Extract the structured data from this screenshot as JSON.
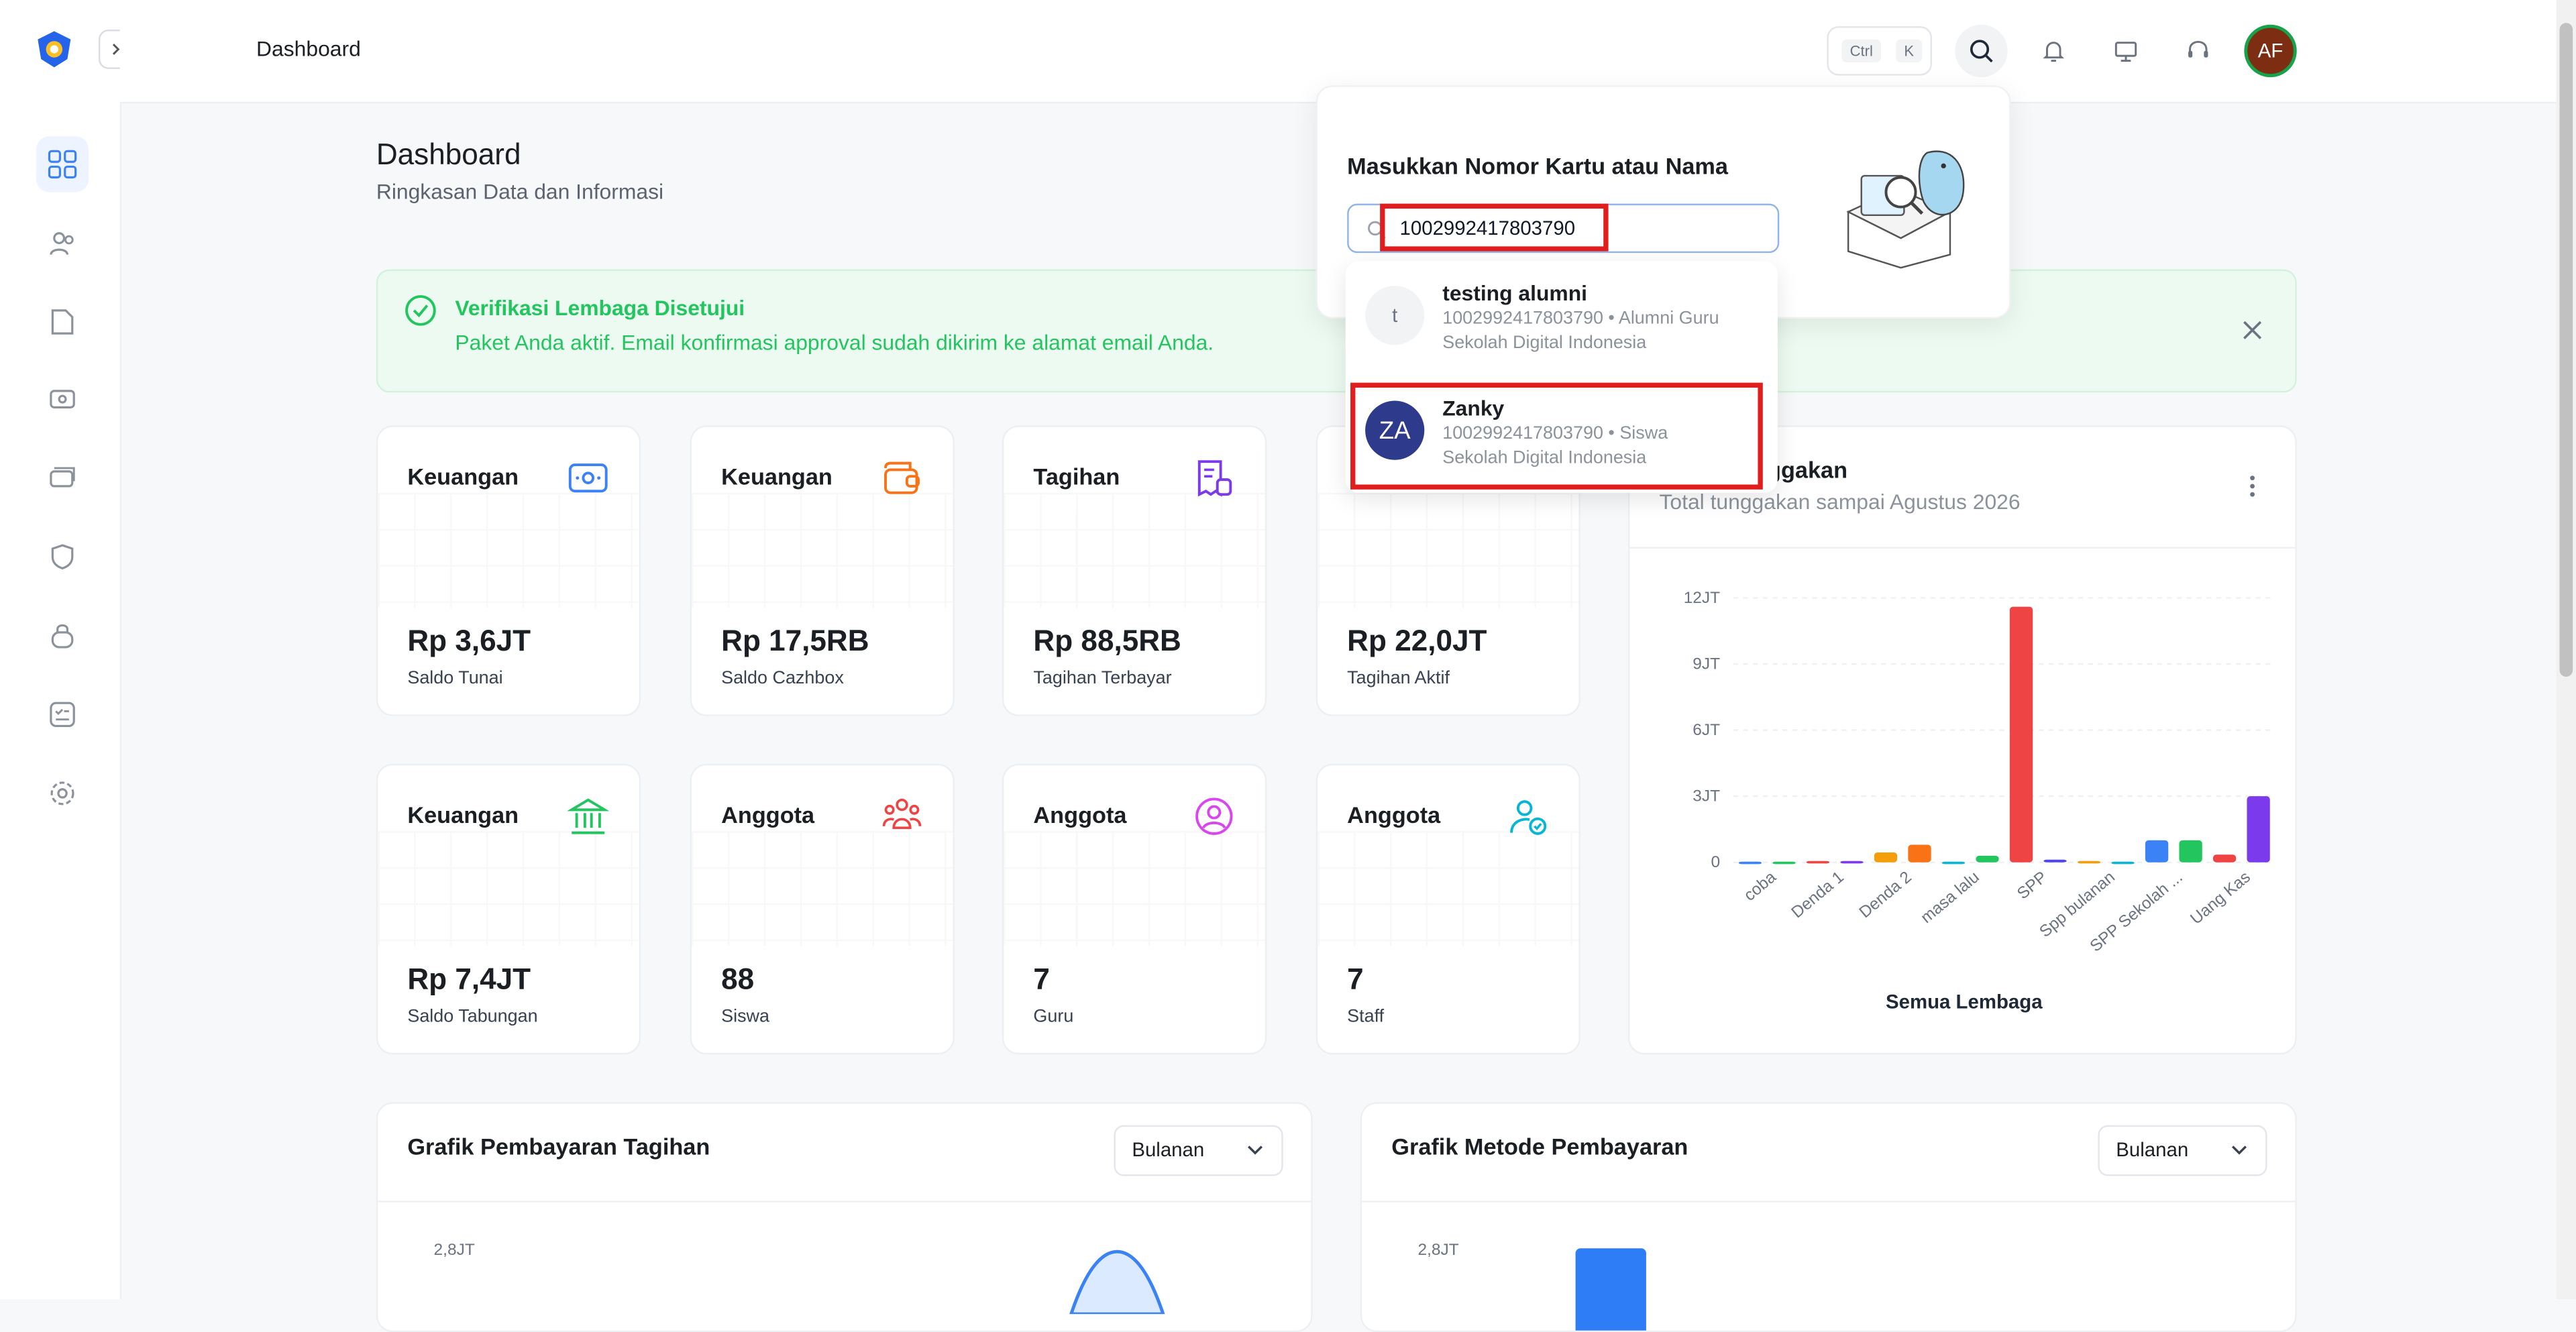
{
  "topbar": {
    "breadcrumb": "Dashboard",
    "shortcut_ctrl": "Ctrl",
    "shortcut_key": "K",
    "avatar_initials": "AF"
  },
  "page": {
    "title": "Dashboard",
    "subtitle": "Ringkasan Data dan Informasi"
  },
  "alert": {
    "title": "Verifikasi Lembaga Disetujui",
    "message": "Paket Anda aktif. Email konfirmasi approval sudah dikirim ke alamat email Anda."
  },
  "cards": [
    {
      "title": "Keuangan",
      "value": "Rp 3,6JT",
      "label": "Saldo Tunai",
      "icon": "cash-icon",
      "color": "#3b82f6"
    },
    {
      "title": "Keuangan",
      "value": "Rp 17,5RB",
      "label": "Saldo Cazhbox",
      "icon": "wallet-icon",
      "color": "#f97316"
    },
    {
      "title": "Tagihan",
      "value": "Rp 88,5RB",
      "label": "Tagihan Terbayar",
      "icon": "bill-icon",
      "color": "#7c3aed"
    },
    {
      "title": "",
      "value": "Rp 22,0JT",
      "label": "Tagihan Aktif",
      "icon": "",
      "color": "#f59e0b"
    },
    {
      "title": "Keuangan",
      "value": "Rp 7,4JT",
      "label": "Saldo Tabungan",
      "icon": "bank-icon",
      "color": "#22c55e"
    },
    {
      "title": "Anggota",
      "value": "88",
      "label": "Siswa",
      "icon": "users-icon",
      "color": "#ef4444"
    },
    {
      "title": "Anggota",
      "value": "7",
      "label": "Guru",
      "icon": "user-circle-icon",
      "color": "#d946ef"
    },
    {
      "title": "Anggota",
      "value": "7",
      "label": "Staff",
      "icon": "user-check-icon",
      "color": "#06b6d4"
    }
  ],
  "tunggakan": {
    "title": "nggakan",
    "subtitle": "Total tunggakan sampai Agustus 2026",
    "footer": "Semua Lembaga"
  },
  "grafik_tagihan": {
    "title": "Grafik Pembayaran Tagihan",
    "select": "Bulanan",
    "ytick": "2,8JT"
  },
  "grafik_metode": {
    "title": "Grafik Metode Pembayaran",
    "select": "Bulanan",
    "ytick": "2,8JT"
  },
  "search_popup": {
    "title": "Masukkan Nomor Kartu atau Nama",
    "query": "1002992417803790",
    "results": [
      {
        "avatar": "t",
        "name": "testing alumni",
        "line1": "1002992417803790 • Alumni Guru",
        "line2": "Sekolah Digital Indonesia"
      },
      {
        "avatar": "ZA",
        "name": "Zanky",
        "line1": "1002992417803790 • Siswa",
        "line2": "Sekolah Digital Indonesia"
      }
    ]
  },
  "chart_data": {
    "type": "bar",
    "categories": [
      "coba",
      "Denda 1",
      "Denda 2",
      "masa lalu",
      "SPP",
      "Spp bulanan",
      "SPP Sekolah ...",
      "Uang Kas"
    ],
    "ytick_labels": [
      "0",
      "3JT",
      "6JT",
      "9JT",
      "12JT"
    ],
    "ylim": [
      0,
      12000000
    ],
    "bars": [
      {
        "value": 30000,
        "color": "#3b82f6"
      },
      {
        "value": 30000,
        "color": "#22c55e"
      },
      {
        "value": 60000,
        "color": "#ef4444"
      },
      {
        "value": 60000,
        "color": "#7c3aed"
      },
      {
        "value": 450000,
        "color": "#f59e0b"
      },
      {
        "value": 800000,
        "color": "#f97316"
      },
      {
        "value": 30000,
        "color": "#06b6d4"
      },
      {
        "value": 300000,
        "color": "#22c55e"
      },
      {
        "value": 11600000,
        "color": "#ef4444"
      },
      {
        "value": 120000,
        "color": "#4f46e5"
      },
      {
        "value": 60000,
        "color": "#f59e0b"
      },
      {
        "value": 30000,
        "color": "#06b6d4"
      },
      {
        "value": 1000000,
        "color": "#3b82f6"
      },
      {
        "value": 1000000,
        "color": "#22c55e"
      },
      {
        "value": 350000,
        "color": "#ef4444"
      },
      {
        "value": 3000000,
        "color": "#7c3aed"
      }
    ]
  }
}
